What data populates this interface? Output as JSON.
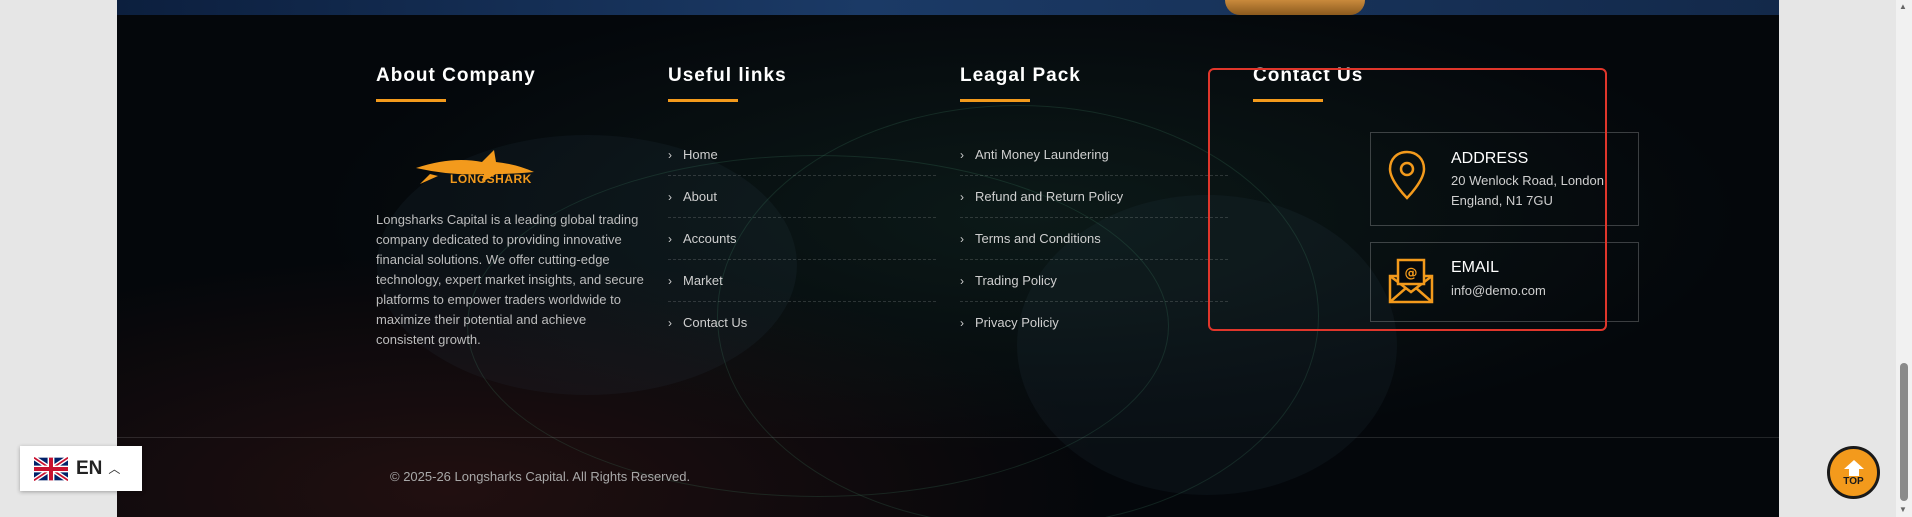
{
  "about": {
    "title": "About Company",
    "logo_text": "LONGSHARK",
    "description": "Longsharks Capital is a leading global trading company dedicated to providing innovative financial solutions. We offer cutting-edge technology, expert market insights, and secure platforms to empower traders worldwide to maximize their potential and achieve consistent growth."
  },
  "useful_links": {
    "title": "Useful links",
    "items": [
      "Home",
      "About",
      "Accounts",
      "Market",
      "Contact Us"
    ]
  },
  "legal": {
    "title": "Leagal Pack",
    "items": [
      "Anti Money Laundering",
      "Refund and Return Policy",
      "Terms and Conditions",
      "Trading Policy",
      "Privacy Policiy"
    ]
  },
  "contact": {
    "title": "Contact Us",
    "address_title": "ADDRESS",
    "address_text": "20 Wenlock Road, London, England, N1 7GU",
    "email_title": "EMAIL",
    "email_text": "info@demo.com"
  },
  "footer": {
    "copyright": "© 2025-26 Longsharks Capital. All Rights Reserved."
  },
  "language": {
    "code": "EN",
    "flag": "uk-flag-icon"
  },
  "back_to_top": {
    "label": "TOP"
  },
  "colors": {
    "accent": "#f39a1c",
    "highlight_border": "#e0362b",
    "footer_bg": "#04070b"
  }
}
